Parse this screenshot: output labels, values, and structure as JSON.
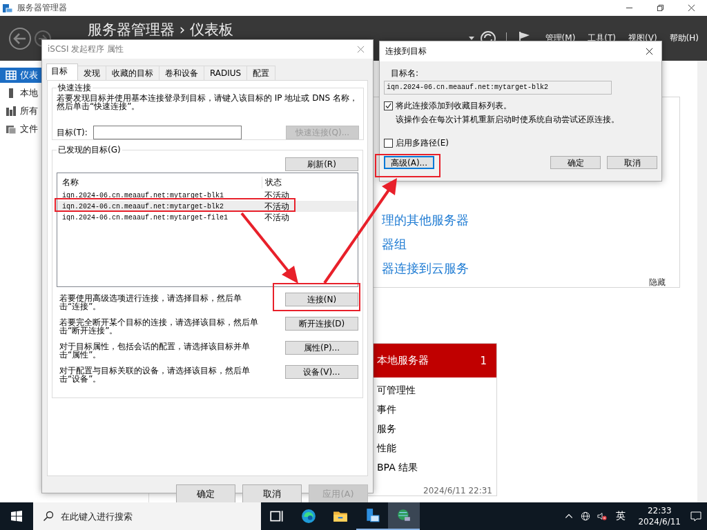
{
  "app": {
    "title": "服务器管理器",
    "breadcrumb": "服务器管理器 › 仪表板",
    "menu": [
      "管理(M)",
      "工具(T)",
      "视图(V)",
      "帮助(H)"
    ]
  },
  "sidebar": {
    "items": [
      {
        "label": "仪表",
        "kind": "dashboard",
        "selected": true
      },
      {
        "label": "本地",
        "kind": "server",
        "selected": false
      },
      {
        "label": "所有",
        "kind": "servers",
        "selected": false
      },
      {
        "label": "文件",
        "kind": "storage",
        "selected": false
      }
    ]
  },
  "dashboard": {
    "links": [
      "理的其他服务器",
      "器组",
      "器连接到云服务"
    ],
    "hide": "隐藏",
    "tile": {
      "title": "本地服务器",
      "count": "1",
      "items": [
        "可管理性",
        "事件",
        "服务",
        "性能",
        "BPA 结果"
      ],
      "timestamp": "2024/6/11 22:31"
    }
  },
  "iscsi_dialog": {
    "title": "iSCSI 发起程序 属性",
    "tabs": [
      {
        "label": "目标",
        "selected": true
      },
      {
        "label": "发现",
        "selected": false
      },
      {
        "label": "收藏的目标",
        "selected": false
      },
      {
        "label": "卷和设备",
        "selected": false
      },
      {
        "label": "RADIUS",
        "selected": false
      },
      {
        "label": "配置",
        "selected": false
      }
    ],
    "quick_connect": {
      "legend": "快速连接",
      "description": "若要发现目标并使用基本连接登录到目标，请键入该目标的 IP 地址或 DNS 名称，然后单击“快速连接”。",
      "target_label": "目标(T):",
      "button": {
        "label": "快速连接(Q)...",
        "disabled": true
      }
    },
    "discovered": {
      "legend": "已发现的目标(G)",
      "refresh": "刷新(R)",
      "columns": [
        "名称",
        "状态"
      ],
      "rows": [
        {
          "name": "iqn.2024-06.cn.meaauf.net:mytarget-blk1",
          "status": "不活动",
          "selected": false
        },
        {
          "name": "iqn.2024-06.cn.meaauf.net:mytarget-blk2",
          "status": "不活动",
          "selected": true
        },
        {
          "name": "iqn.2024-06.cn.meaauf.net:mytarget-file1",
          "status": "不活动",
          "selected": false
        }
      ]
    },
    "actions": [
      {
        "description": "若要使用高级选项进行连接，请选择目标，然后单击“连接”。",
        "button": "连接(N)"
      },
      {
        "description": "若要完全断开某个目标的连接，请选择该目标，然后单击“断开连接”。",
        "button": "断开连接(D)"
      },
      {
        "description": "对于目标属性，包括会话的配置，请选择该目标并单击“属性”。",
        "button": "属性(P)..."
      },
      {
        "description": "对于配置与目标关联的设备，请选择该目标，然后单击“设备”。",
        "button": "设备(V)..."
      }
    ],
    "buttons": [
      {
        "label": "确定",
        "disabled": false
      },
      {
        "label": "取消",
        "disabled": false
      },
      {
        "label": "应用(A)",
        "disabled": true
      }
    ]
  },
  "connect_dialog": {
    "title": "连接到目标",
    "target_label": "目标名:",
    "target_value": "iqn.2024-06.cn.meaauf.net:mytarget-blk2",
    "options": [
      {
        "label": "将此连接添加到收藏目标列表。",
        "checked": true,
        "note": "该操作会在每次计算机重新启动时使系统自动尝试还原连接。"
      },
      {
        "label": "启用多路径(E)",
        "checked": false
      }
    ],
    "buttons": [
      {
        "label": "高级(A)...",
        "focused": true
      },
      {
        "label": "确定",
        "focused": false
      },
      {
        "label": "取消",
        "focused": false
      }
    ]
  },
  "taskbar": {
    "search_placeholder": "在此键入进行搜索",
    "apps": [
      {
        "kind": "task-view",
        "running": false,
        "active": false
      },
      {
        "kind": "browser",
        "running": false,
        "active": false
      },
      {
        "kind": "folder",
        "running": false,
        "active": false
      },
      {
        "kind": "server-manager",
        "running": true,
        "active": false
      },
      {
        "kind": "network",
        "running": true,
        "active": true
      }
    ],
    "ime": "英",
    "time": "22:33",
    "date": "2024/6/11"
  }
}
